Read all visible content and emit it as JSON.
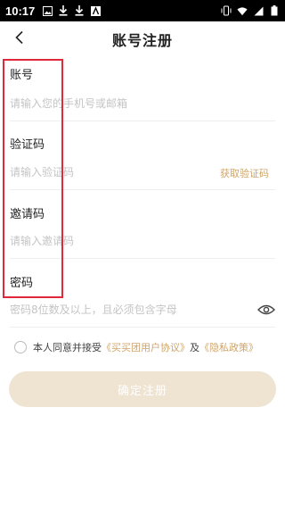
{
  "status_bar": {
    "time": "10:17",
    "left_icons": [
      "image-icon",
      "download-icon",
      "download-icon",
      "app-icon"
    ],
    "right_icons": [
      "vibrate-icon",
      "wifi-icon",
      "signal-icon",
      "battery-icon"
    ]
  },
  "header": {
    "back_icon": "back-arrow-icon",
    "title": "账号注册"
  },
  "form": {
    "account": {
      "label": "账号",
      "placeholder": "请输入您的手机号或邮箱",
      "value": ""
    },
    "code": {
      "label": "验证码",
      "placeholder": "请输入验证码",
      "value": "",
      "action": "获取验证码"
    },
    "invite": {
      "label": "邀请码",
      "placeholder": "请输入邀请码",
      "value": ""
    },
    "password": {
      "label": "密码",
      "placeholder": "密码8位数及以上，且必须包含字母",
      "value": "",
      "toggle_icon": "eye-icon"
    }
  },
  "agreement": {
    "prefix": "本人同意并接受",
    "user_agreement": "《买买团用户协议》",
    "and": "及",
    "privacy_policy": "《隐私政策》",
    "checked": false
  },
  "submit": {
    "label": "确定注册"
  },
  "colors": {
    "accent": "#cfa56b",
    "button_bg": "#efe4d2",
    "highlight": "#e0293a",
    "placeholder": "#c4c4c4"
  }
}
